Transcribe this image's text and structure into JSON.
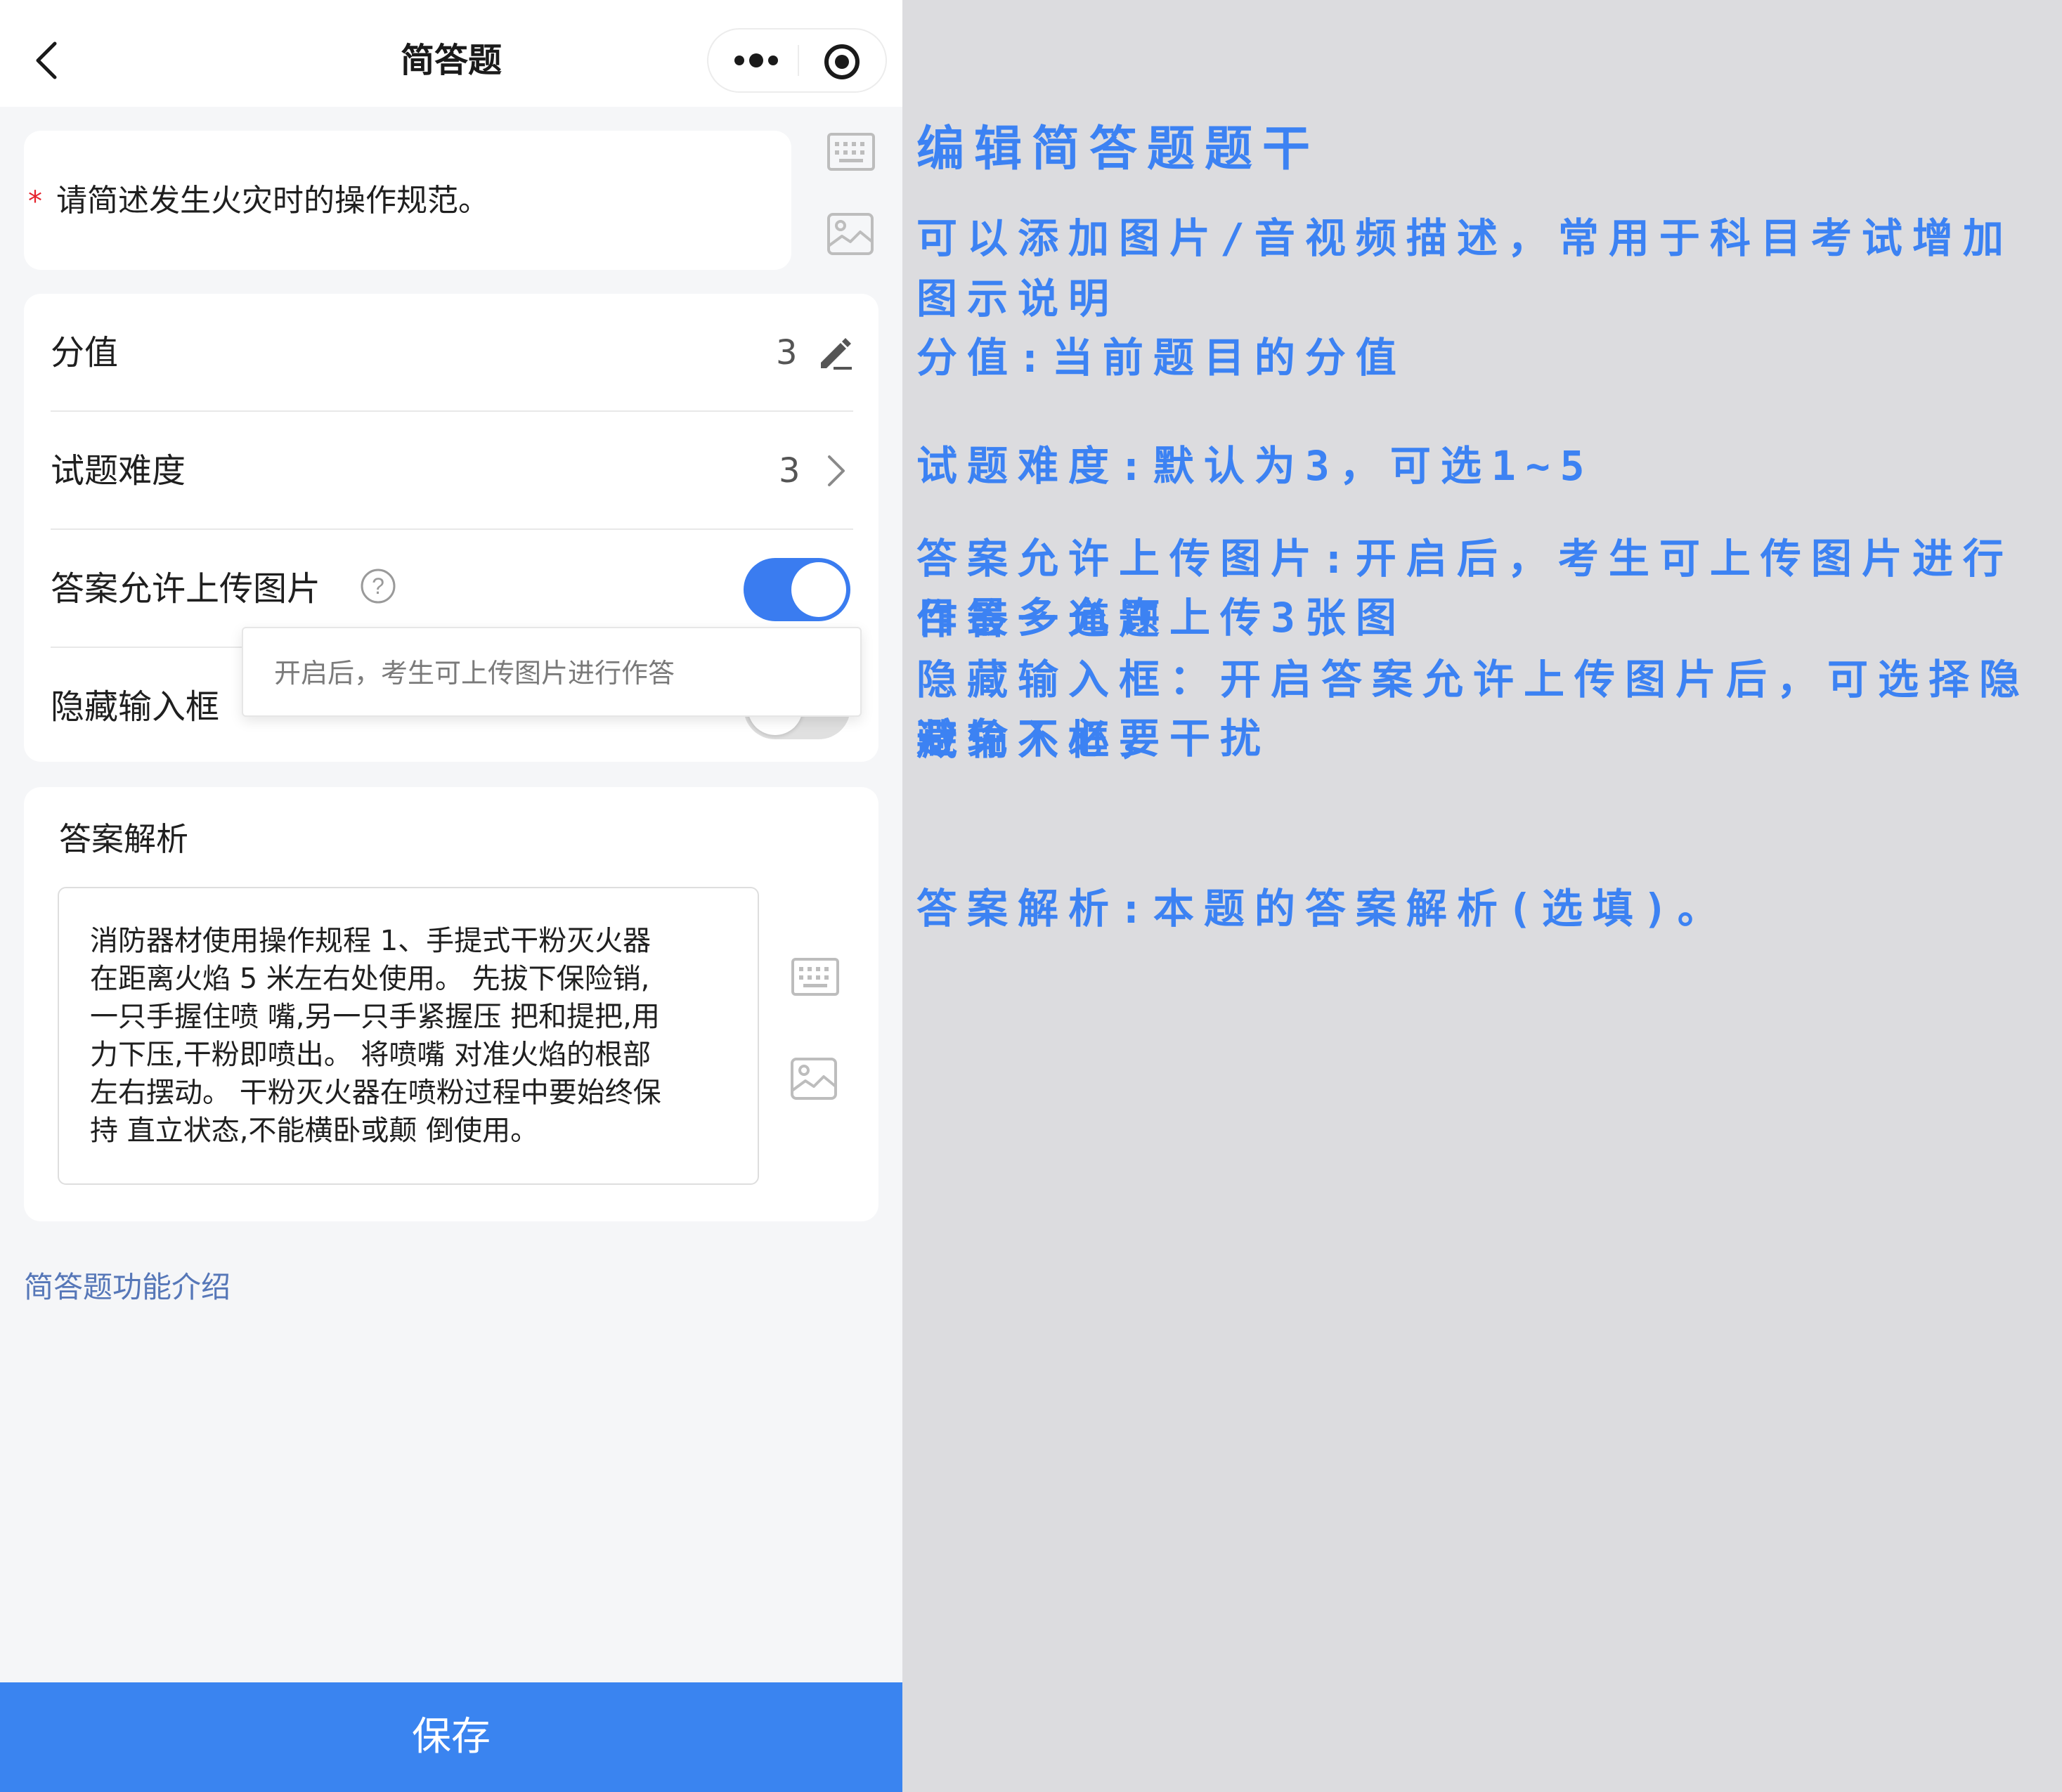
{
  "navbar": {
    "title": "简答题",
    "back_icon": "chevron-left-icon",
    "more_icon": "more-dots-icon",
    "target_icon": "target-icon"
  },
  "question": {
    "required_mark": "*",
    "stem": "请简述发生火灾时的操作规范。",
    "keyboard_icon": "keyboard-icon",
    "image_icon": "image-icon"
  },
  "settings": {
    "score_label": "分值",
    "score_value": "3",
    "score_edit_icon": "pencil-icon",
    "difficulty_label": "试题难度",
    "difficulty_value": "3",
    "difficulty_arrow_icon": "chevron-right-icon",
    "upload_label": "答案允许上传图片",
    "upload_help_icon": "question-circle-icon",
    "upload_enabled": true,
    "tooltip": "开启后，考生可上传图片进行作答",
    "hide_input_label": "隐藏输入框",
    "hide_input_enabled": false
  },
  "analysis": {
    "title": "答案解析",
    "text": "消防器材使用操作规程 1、手提式干粉灭火器\n在距离火焰 5 米左右处使用。 先拔下保险销,\n一只手握住喷 嘴,另一只手紧握压 把和提把,用\n力下压,干粉即喷出。 将喷嘴 对准火焰的根部\n左右摆动。 干粉灭火器在喷粉过程中要始终保\n持 直立状态,不能横卧或颠 倒使用。"
  },
  "intro_link": "简答题功能介绍",
  "save_label": "保存",
  "annotations": {
    "edit_stem": "编辑简答题题干",
    "add_media": "可以添加图片/音视频描述，常用于科目考试增加图示说明",
    "score": "分值:当前题目的分值",
    "difficulty": "试题难度:默认为3，可选1~5",
    "upload_line1": "答案允许上传图片:开启后，考生可上传图片进行作答一道题",
    "upload_line2": "目最多允许上传3张图",
    "hide_line1": "隐藏输入框：开启答案允许上传图片后，可选择隐藏输入框，",
    "hide_line2": "避免不必要干扰",
    "analysis": "答案解析:本题的答案解析(选填)。"
  },
  "colors": {
    "accent": "#3a84f0",
    "annotation": "#3c82f3",
    "required": "#e5232d",
    "link": "#5677b8"
  }
}
